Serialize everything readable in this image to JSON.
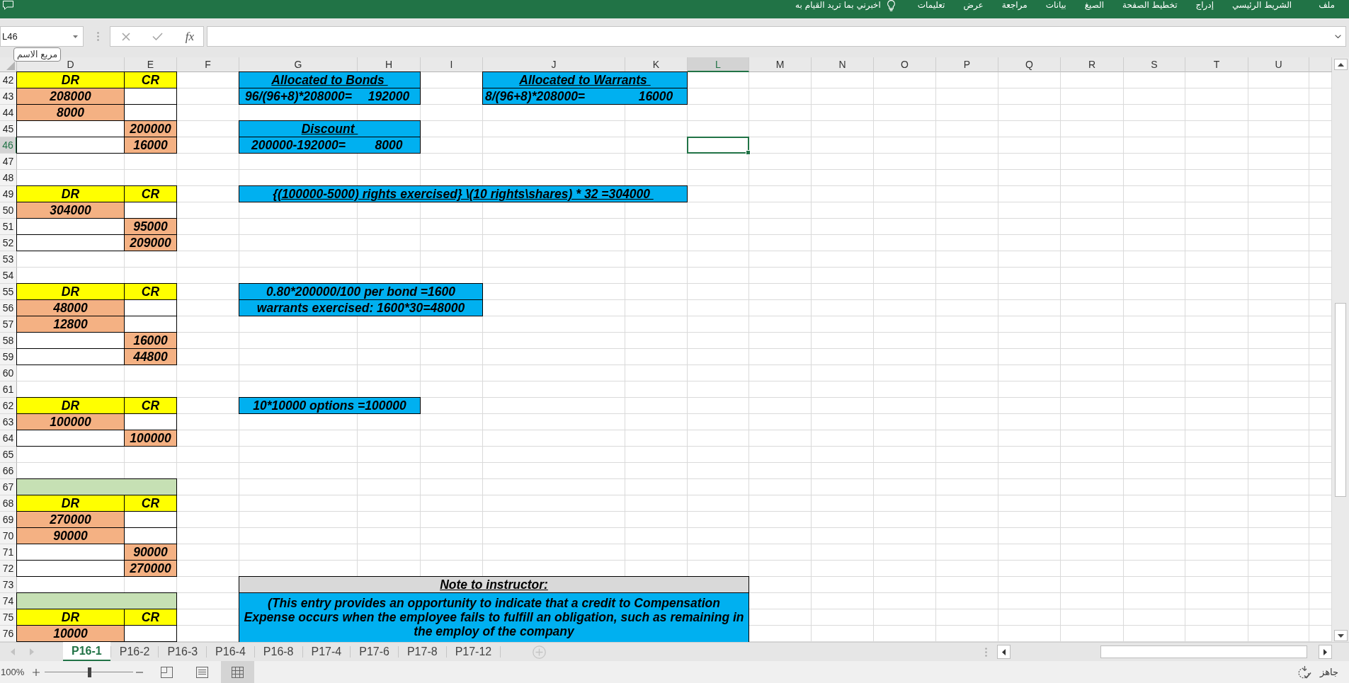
{
  "ribbon": {
    "tabs": [
      {
        "label": "ملف"
      },
      {
        "label": "الشريط الرئيسي"
      },
      {
        "label": "إدراج"
      },
      {
        "label": "تخطيط الصفحة"
      },
      {
        "label": "الصيغ"
      },
      {
        "label": "بيانات"
      },
      {
        "label": "مراجعة"
      },
      {
        "label": "عرض"
      },
      {
        "label": "تعليمات"
      }
    ],
    "tell_me": "اخبرني بما تريد القيام به"
  },
  "formula_bar": {
    "name_box": "L46",
    "name_box_tooltip": "مربع الاسم",
    "function_button": "fx"
  },
  "sheet": {
    "columns": [
      {
        "label": "D",
        "selected": false
      },
      {
        "label": "E",
        "selected": false
      },
      {
        "label": "F",
        "selected": false
      },
      {
        "label": "G",
        "selected": false
      },
      {
        "label": "H",
        "selected": false
      },
      {
        "label": "I",
        "selected": false
      },
      {
        "label": "J",
        "selected": false
      },
      {
        "label": "K",
        "selected": false
      },
      {
        "label": "L",
        "selected": true
      },
      {
        "label": "M",
        "selected": false
      },
      {
        "label": "N",
        "selected": false
      },
      {
        "label": "O",
        "selected": false
      },
      {
        "label": "P",
        "selected": false
      },
      {
        "label": "Q",
        "selected": false
      },
      {
        "label": "R",
        "selected": false
      },
      {
        "label": "S",
        "selected": false
      },
      {
        "label": "T",
        "selected": false
      },
      {
        "label": "U",
        "selected": false
      }
    ],
    "rows": [
      {
        "label": "42",
        "selected": false,
        "cells": [
          {
            "kind": "header",
            "text": "DR"
          },
          {
            "kind": "header",
            "text": "CR"
          },
          {
            "kind": "plain"
          },
          {
            "kind": "caption",
            "text": "Allocated to Bonds "
          },
          {
            "kind": "merged"
          },
          {
            "kind": "plain"
          },
          {
            "kind": "caption",
            "text": "Allocated to Warrants "
          },
          {
            "kind": "merged"
          }
        ]
      },
      {
        "label": "43",
        "selected": false,
        "cells": [
          {
            "kind": "amount",
            "text": "208000"
          },
          {
            "kind": "blank"
          },
          {
            "kind": "plain"
          },
          {
            "kind": "pair",
            "text": "96/(96+8)*208000=",
            "value": "192000"
          },
          {
            "kind": "merged"
          },
          {
            "kind": "plain"
          },
          {
            "kind": "leftpair",
            "text": "8/(96+8)*208000=",
            "value": "16000"
          },
          {
            "kind": "merged"
          }
        ]
      },
      {
        "label": "44",
        "selected": false,
        "cells": [
          {
            "kind": "amount",
            "text": "8000"
          },
          {
            "kind": "blank"
          }
        ]
      },
      {
        "label": "45",
        "selected": false,
        "cells": [
          {
            "kind": "blank"
          },
          {
            "kind": "amount",
            "text": "200000"
          },
          {
            "kind": "plain"
          },
          {
            "kind": "caption",
            "text": "Discount "
          },
          {
            "kind": "merged"
          }
        ]
      },
      {
        "label": "46",
        "selected": true,
        "cells": [
          {
            "kind": "blank"
          },
          {
            "kind": "amount",
            "text": "16000"
          },
          {
            "kind": "plain"
          },
          {
            "kind": "pair",
            "text": "200000-192000=",
            "value": "8000"
          },
          {
            "kind": "merged"
          }
        ]
      },
      {
        "label": "47",
        "selected": false
      },
      {
        "label": "48",
        "selected": false
      },
      {
        "label": "49",
        "selected": false,
        "cells": [
          {
            "kind": "header",
            "text": "DR"
          },
          {
            "kind": "header",
            "text": "CR"
          },
          {
            "kind": "plain"
          },
          {
            "kind": "caption",
            "text": "{(100000-5000) rights exercised} \\(10 rights\\shares) * 32 =304000 "
          },
          {
            "kind": "merged"
          },
          {
            "kind": "merged"
          },
          {
            "kind": "merged"
          },
          {
            "kind": "merged"
          }
        ]
      },
      {
        "label": "50",
        "selected": false,
        "cells": [
          {
            "kind": "amount",
            "text": "304000"
          },
          {
            "kind": "blank"
          }
        ]
      },
      {
        "label": "51",
        "selected": false,
        "cells": [
          {
            "kind": "blank"
          },
          {
            "kind": "amount",
            "text": "95000"
          }
        ]
      },
      {
        "label": "52",
        "selected": false,
        "cells": [
          {
            "kind": "blank"
          },
          {
            "kind": "amount",
            "text": "209000"
          }
        ]
      },
      {
        "label": "53",
        "selected": false
      },
      {
        "label": "54",
        "selected": false
      },
      {
        "label": "55",
        "selected": false,
        "cells": [
          {
            "kind": "header",
            "text": "DR"
          },
          {
            "kind": "header",
            "text": "CR"
          },
          {
            "kind": "plain"
          },
          {
            "kind": "calc",
            "text": "0.80*200000/100 per bond =1600"
          },
          {
            "kind": "merged"
          },
          {
            "kind": "merged"
          }
        ]
      },
      {
        "label": "56",
        "selected": false,
        "cells": [
          {
            "kind": "amount",
            "text": "48000"
          },
          {
            "kind": "blank"
          },
          {
            "kind": "plain"
          },
          {
            "kind": "calc",
            "text": "warrants exercised: 1600*30=48000"
          },
          {
            "kind": "merged"
          },
          {
            "kind": "merged"
          }
        ]
      },
      {
        "label": "57",
        "selected": false,
        "cells": [
          {
            "kind": "amount",
            "text": "12800"
          },
          {
            "kind": "blank"
          }
        ]
      },
      {
        "label": "58",
        "selected": false,
        "cells": [
          {
            "kind": "blank"
          },
          {
            "kind": "amount",
            "text": "16000"
          }
        ]
      },
      {
        "label": "59",
        "selected": false,
        "cells": [
          {
            "kind": "blank"
          },
          {
            "kind": "amount",
            "text": "44800"
          }
        ]
      },
      {
        "label": "60",
        "selected": false
      },
      {
        "label": "61",
        "selected": false
      },
      {
        "label": "62",
        "selected": false,
        "cells": [
          {
            "kind": "header",
            "text": "DR"
          },
          {
            "kind": "header",
            "text": "CR"
          },
          {
            "kind": "plain"
          },
          {
            "kind": "calc",
            "text": "10*10000 options =100000"
          },
          {
            "kind": "merged"
          }
        ]
      },
      {
        "label": "63",
        "selected": false,
        "cells": [
          {
            "kind": "amount",
            "text": "100000"
          },
          {
            "kind": "blank"
          }
        ]
      },
      {
        "label": "64",
        "selected": false,
        "cells": [
          {
            "kind": "blank"
          },
          {
            "kind": "amount",
            "text": "100000"
          }
        ]
      },
      {
        "label": "65",
        "selected": false
      },
      {
        "label": "66",
        "selected": false
      },
      {
        "label": "67",
        "selected": false,
        "cells": [
          {
            "kind": "band"
          },
          {
            "kind": "merged"
          }
        ]
      },
      {
        "label": "68",
        "selected": false,
        "cells": [
          {
            "kind": "header",
            "text": "DR"
          },
          {
            "kind": "header",
            "text": "CR"
          }
        ]
      },
      {
        "label": "69",
        "selected": false,
        "cells": [
          {
            "kind": "amount",
            "text": "270000"
          },
          {
            "kind": "blank"
          }
        ]
      },
      {
        "label": "70",
        "selected": false,
        "cells": [
          {
            "kind": "amount",
            "text": "90000"
          },
          {
            "kind": "blank"
          }
        ]
      },
      {
        "label": "71",
        "selected": false,
        "cells": [
          {
            "kind": "blank"
          },
          {
            "kind": "amount",
            "text": "90000"
          }
        ]
      },
      {
        "label": "72",
        "selected": false,
        "cells": [
          {
            "kind": "blank"
          },
          {
            "kind": "amount",
            "text": "270000"
          }
        ]
      },
      {
        "label": "73",
        "selected": false,
        "cells": [
          {
            "kind": "plain"
          },
          {
            "kind": "plain"
          },
          {
            "kind": "plain"
          },
          {
            "kind": "title",
            "text": "Note to instructor:"
          },
          {
            "kind": "merged"
          },
          {
            "kind": "merged"
          },
          {
            "kind": "merged"
          },
          {
            "kind": "merged"
          },
          {
            "kind": "merged"
          }
        ]
      },
      {
        "label": "74",
        "selected": false,
        "cells": [
          {
            "kind": "band"
          },
          {
            "kind": "merged"
          },
          {
            "kind": "plain"
          },
          {
            "kind": "note",
            "text": "(This entry provides an opportunity to indicate that a credit to Compensation Expense occurs when the employee fails to fulfill an obligation, such as remaining in the employ of the company"
          },
          {
            "kind": "merged"
          },
          {
            "kind": "merged"
          },
          {
            "kind": "merged"
          },
          {
            "kind": "merged"
          },
          {
            "kind": "merged"
          }
        ]
      },
      {
        "label": "75",
        "selected": false,
        "cells": [
          {
            "kind": "header",
            "text": "DR"
          },
          {
            "kind": "header",
            "text": "CR"
          }
        ]
      },
      {
        "label": "76",
        "selected": false,
        "cells": [
          {
            "kind": "amount",
            "text": "10000"
          },
          {
            "kind": "blank"
          }
        ]
      }
    ]
  },
  "sheet_tabs": [
    {
      "label": "P16-1",
      "selected": true
    },
    {
      "label": "P16-2",
      "selected": false
    },
    {
      "label": "P16-3",
      "selected": false
    },
    {
      "label": "P16-4",
      "selected": false
    },
    {
      "label": "P16-8",
      "selected": false
    },
    {
      "label": "P17-4",
      "selected": false
    },
    {
      "label": "P17-6",
      "selected": false
    },
    {
      "label": "P17-8",
      "selected": false
    },
    {
      "label": "P17-12",
      "selected": false
    }
  ],
  "status_bar": {
    "zoom": "100%",
    "zoom_slider": {
      "level": 0.5
    },
    "views": [
      {
        "kind": "pagebreak",
        "selected": false
      },
      {
        "kind": "layout",
        "selected": false
      },
      {
        "kind": "normal",
        "selected": true
      }
    ],
    "status": "جاهز"
  }
}
